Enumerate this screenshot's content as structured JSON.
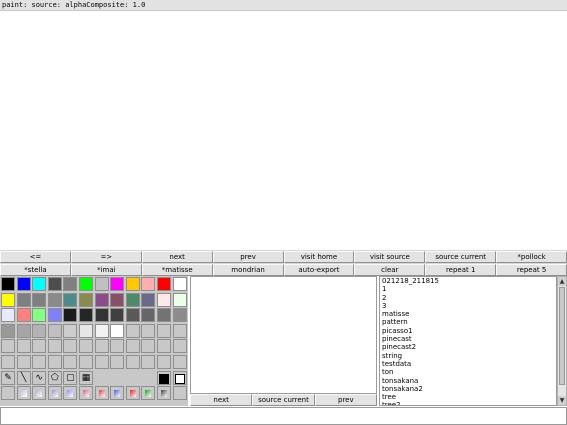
{
  "status_text": "paint: source: alphaComposite: 1.0",
  "toolbar": {
    "row1": [
      "<=",
      "=>",
      "next",
      "prev",
      "visit home",
      "visit source",
      "source current",
      "*pollock"
    ],
    "row2": [
      "*stella",
      "*imai",
      "*matisse",
      "mondrian",
      "auto-export",
      "clear",
      "repeat 1",
      "repeat 5"
    ]
  },
  "palette": {
    "colors": [
      [
        "#000000",
        "#0000ff",
        "#00ffff",
        "#4d4d4d",
        "#808080",
        "#00ff00",
        "#c0c0c0",
        "#ff00ff",
        "#ffc800",
        "#ffafaf",
        "#ff0000",
        "#ffffff"
      ],
      [
        "#ffff00",
        "#7f7f7f",
        "#7f7f7f",
        "#8a8a8a",
        "#4d8a8a",
        "#8a8a4d",
        "#8a4d8a",
        "#8a4d6a",
        "#4d8a6a",
        "#6a6a8a",
        "#ffe8e8",
        "#e8ffe8"
      ],
      [
        "#e8e8ff",
        "#ff8080",
        "#80ff80",
        "#8080ff",
        "#1a1a1a",
        "#262626",
        "#333333",
        "#404040",
        "#595959",
        "#666666",
        "#737373",
        "#8c8c8c"
      ],
      [
        "#999999",
        "#a6a6a6",
        "#b3b3b3",
        "#bfbfbf",
        "#cccccc",
        "#e6e6e6",
        "#f2f2f2",
        "#ffffff",
        "#c8c8c8",
        "#c8c8c8",
        "#c8c8c8",
        "#c8c8c8"
      ],
      [
        "#c8c8c8",
        "#c8c8c8",
        "#c8c8c8",
        "#c8c8c8",
        "#c8c8c8",
        "#c8c8c8",
        "#c8c8c8",
        "#c8c8c8",
        "#c8c8c8",
        "#c8c8c8",
        "#c8c8c8",
        "#c8c8c8"
      ],
      [
        "#c8c8c8",
        "#c8c8c8",
        "#c8c8c8",
        "#c8c8c8",
        "#c8c8c8",
        "#c8c8c8",
        "#c8c8c8",
        "#c8c8c8",
        "#c8c8c8",
        "#c8c8c8",
        "#c8c8c8",
        "#c8c8c8"
      ]
    ],
    "tools": [
      "pencil-icon",
      "line-icon",
      "curve-icon",
      "polygon-icon",
      "rectangle-icon",
      "image-icon"
    ],
    "current_colors": [
      "#000000",
      "#ffffff"
    ]
  },
  "mid_buttons": [
    "next",
    "source current",
    "prev"
  ],
  "file_list": [
    "021218_211815",
    "1",
    "2",
    "3",
    "matisse",
    "pattern",
    "picasso1",
    "pinecast",
    "pinecast2",
    "string",
    "testdata",
    "ton",
    "tonsakana",
    "tonsakana2",
    "tree",
    "tree2"
  ],
  "input_value": ""
}
